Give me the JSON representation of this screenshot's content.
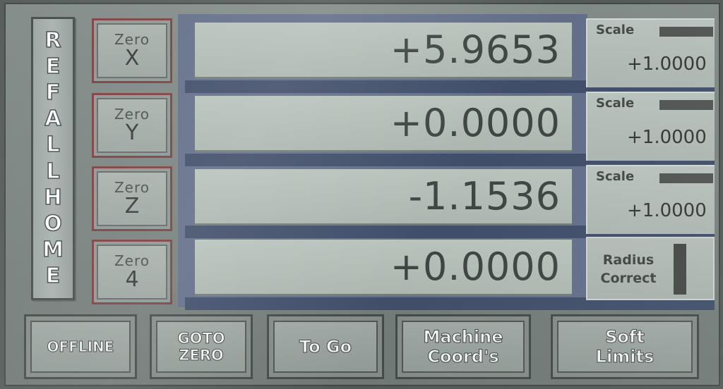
{
  "ref_all_home": [
    "R",
    "E",
    "F",
    "A",
    "L",
    "L",
    "H",
    "O",
    "M",
    "E"
  ],
  "axes": [
    {
      "zero_top": "Zero",
      "zero_axis": "X",
      "dro_value": "+5.9653",
      "side_label": "Scale",
      "side_value": "+1.0000"
    },
    {
      "zero_top": "Zero",
      "zero_axis": "Y",
      "dro_value": "+0.0000",
      "side_label": "Scale",
      "side_value": "+1.0000"
    },
    {
      "zero_top": "Zero",
      "zero_axis": "Z",
      "dro_value": "-1.1536",
      "side_label": "Scale",
      "side_value": "+1.0000"
    },
    {
      "zero_top": "Zero",
      "zero_axis": "4",
      "dro_value": "+0.0000",
      "side_label": "Radius\nCorrect",
      "side_value": ""
    }
  ],
  "bottom_buttons": {
    "offline": "OFFLINE",
    "goto_zero": "GOTO\nZERO",
    "to_go": "To Go",
    "machine_coords": "Machine\nCoord's",
    "soft_limits": "Soft\nLimits"
  },
  "colors": {
    "panel": "#7a8480",
    "dro_background": "#b2bdb6",
    "zero_border": "#7a3b3b",
    "axis_strip": "#5f6b86"
  },
  "icons": {
    "scale_indicator": "led-bar",
    "radius_indicator": "led-bar"
  }
}
